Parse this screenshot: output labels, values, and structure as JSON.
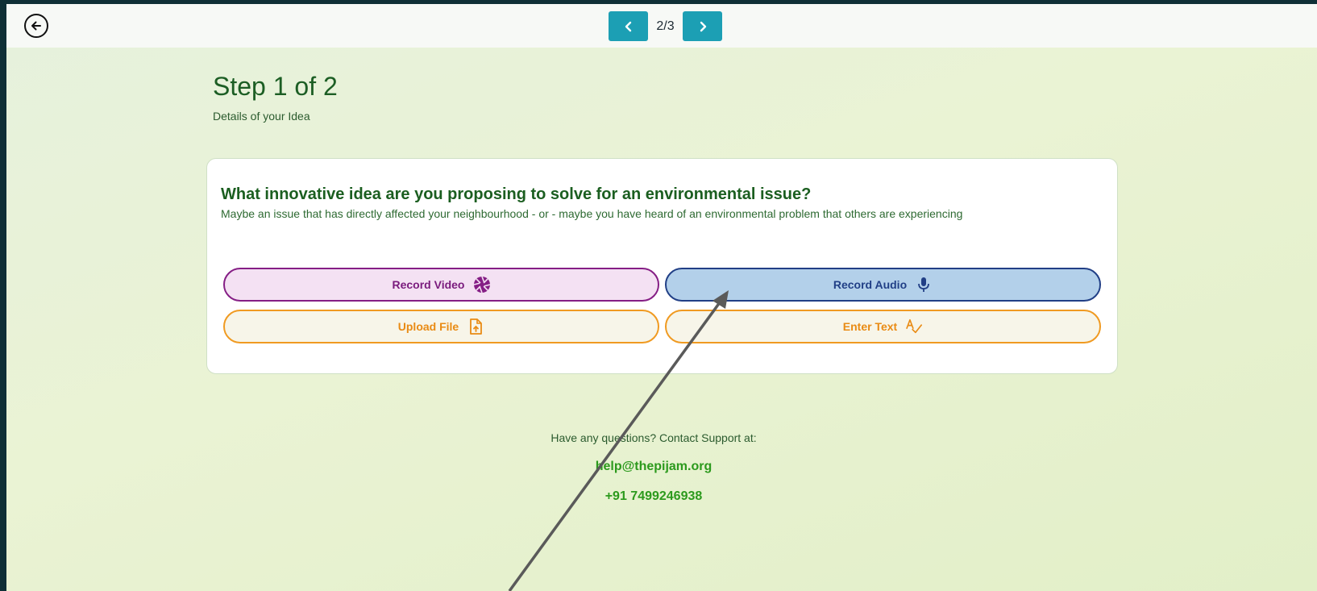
{
  "topbar": {
    "back_icon": "arrow-left-circle-icon",
    "prev_icon": "chevron-left-icon",
    "next_icon": "chevron-right-icon",
    "page_indicator": "2/3"
  },
  "header": {
    "title": "Step 1 of 2",
    "subtitle": "Details of your Idea"
  },
  "card": {
    "question": "What innovative idea are you proposing to solve for an environmental issue?",
    "description": "Maybe an issue that has directly affected your neighbourhood - or - maybe you have heard of an environmental problem that others are experiencing",
    "options": [
      {
        "label": "Record Video",
        "icon": "camera-aperture-icon",
        "color": "#851e85"
      },
      {
        "label": "Record Audio",
        "icon": "microphone-icon",
        "color": "#213f86"
      },
      {
        "label": "Upload File",
        "icon": "file-upload-icon",
        "color": "#f09a21"
      },
      {
        "label": "Enter Text",
        "icon": "spellcheck-icon",
        "color": "#f09a21"
      }
    ]
  },
  "support": {
    "text": "Have any questions? Contact Support at:",
    "email": "help@thepijam.org",
    "phone": "+91 7499246938"
  },
  "colors": {
    "accent": "#1c9fb4",
    "heading_green": "#1b5e20",
    "link_green": "#2c9a1d"
  }
}
